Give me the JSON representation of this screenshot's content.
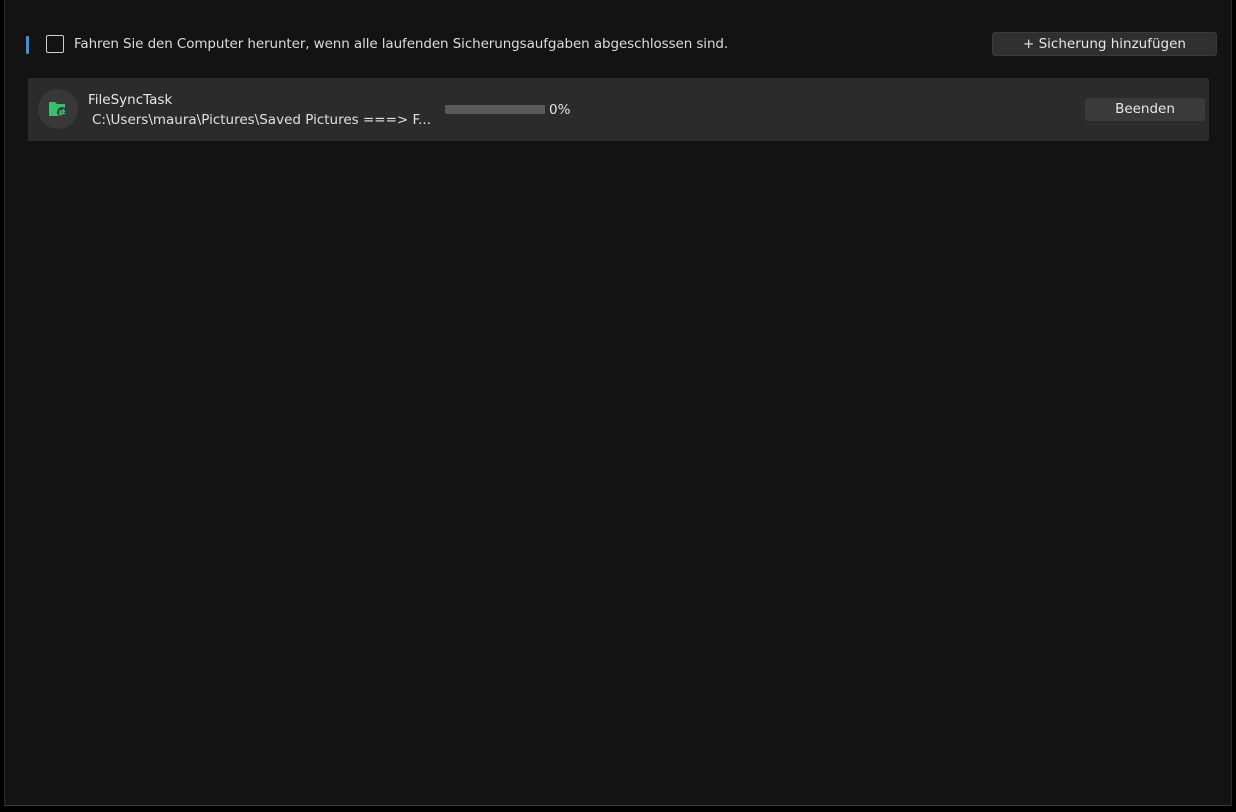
{
  "colors": {
    "accent": "#3c8ee6",
    "window_bg": "#131313",
    "row_bg": "#2b2b2b",
    "icon_green": "#33c26b",
    "progress_fill": "#3c8ee6"
  },
  "toolbar": {
    "shutdown_checked": false,
    "shutdown_label": "Fahren Sie den Computer herunter, wenn alle laufenden Sicherungsaufgaben abgeschlossen sind.",
    "add_button_label": "+ Sicherung hinzufügen"
  },
  "tasks": [
    {
      "icon": "folder-sync-icon",
      "name": "FileSyncTask",
      "path": "C:\\Users\\maura\\Pictures\\Saved Pictures ===> F...",
      "progress": 0,
      "progress_label": "0%",
      "stop_label": "Beenden"
    }
  ]
}
